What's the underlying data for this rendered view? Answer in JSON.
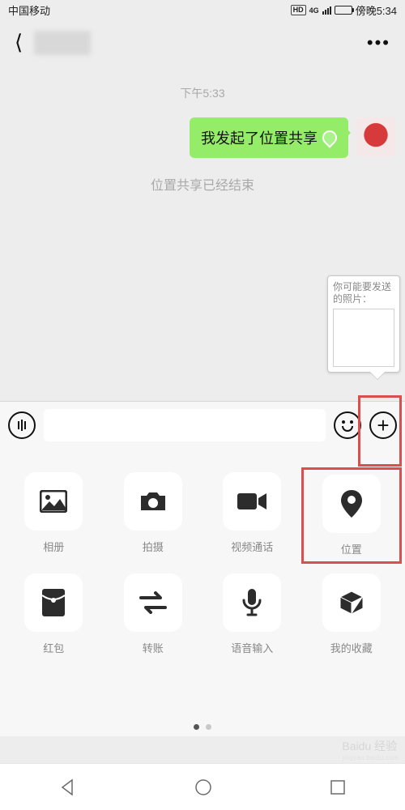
{
  "status": {
    "carrier": "中国移动",
    "hd": "HD",
    "net": "4G",
    "time": "傍晚5:34"
  },
  "nav": {
    "menu": "•••"
  },
  "chat": {
    "timestamp": "下午5:33",
    "message": "我发起了位置共享",
    "system": "位置共享已经结束"
  },
  "photo_tip": "你可能要发送的照片：",
  "panel": {
    "items": [
      {
        "label": "相册"
      },
      {
        "label": "拍摄"
      },
      {
        "label": "视频通话"
      },
      {
        "label": "位置"
      },
      {
        "label": "红包"
      },
      {
        "label": "转账"
      },
      {
        "label": "语音输入"
      },
      {
        "label": "我的收藏"
      }
    ]
  },
  "watermark": {
    "brand": "Baidu 经验",
    "sub": "jingyan.baidu.com"
  }
}
